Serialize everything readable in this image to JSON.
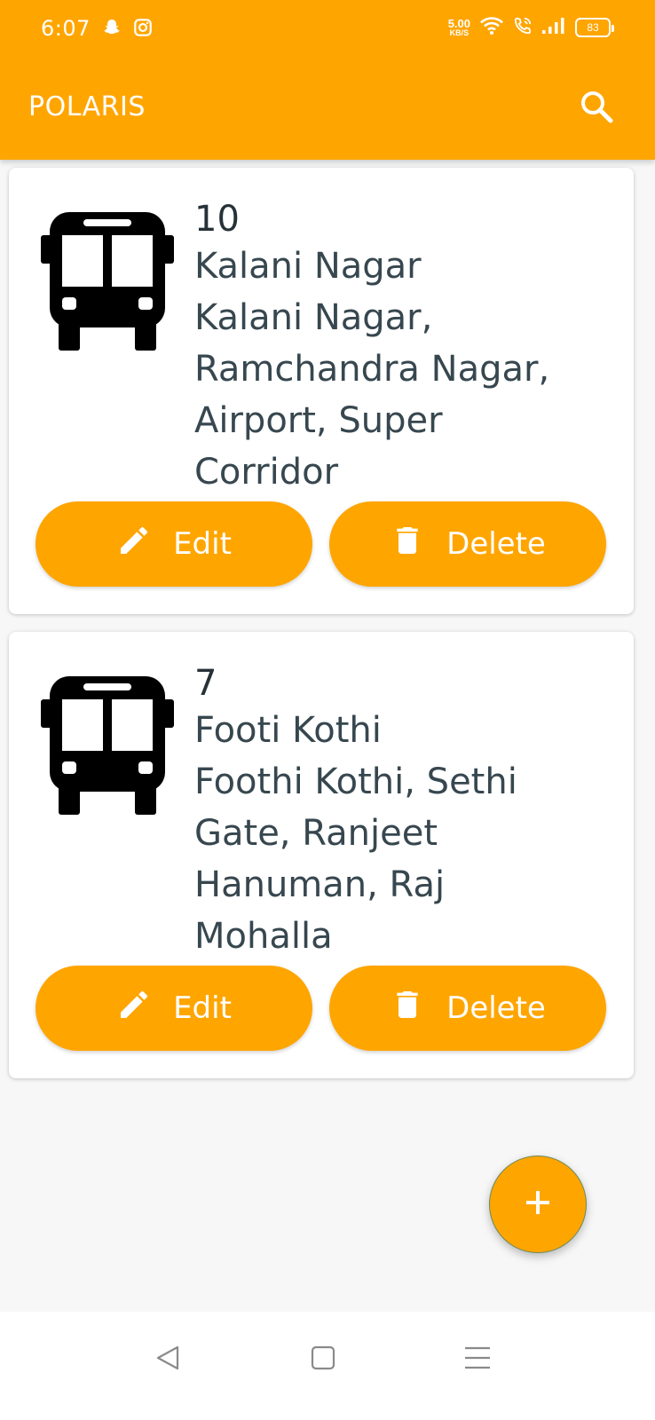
{
  "status_bar": {
    "time": "6:07",
    "net_speed_value": "5.00",
    "net_speed_unit": "KB/S",
    "battery": "83",
    "left_icons": [
      "snapchat-icon",
      "instagram-icon"
    ],
    "right_icons": [
      "wifi-icon",
      "wifi-call-icon",
      "signal-icon",
      "battery-icon"
    ]
  },
  "app_bar": {
    "title": "POLARIS",
    "search_icon": "search-icon"
  },
  "routes": [
    {
      "number": "10",
      "name": "Kalani Nagar",
      "stops_line1": "Kalani Nagar,",
      "stops_line2": "Ramchandra Nagar,",
      "stops_line3": "Airport,  Super",
      "stops_line4": "Corridor",
      "icon": "bus-icon",
      "edit_label": "Edit",
      "delete_label": "Delete"
    },
    {
      "number": "7",
      "name": "Footi Kothi",
      "stops_line1": "Foothi Kothi,  Sethi",
      "stops_line2": "Gate,  Ranjeet",
      "stops_line3": "Hanuman,  Raj",
      "stops_line4": "Mohalla",
      "icon": "bus-icon",
      "edit_label": "Edit",
      "delete_label": "Delete"
    }
  ],
  "fab": {
    "icon": "plus-icon"
  },
  "nav_bar": {
    "icons": [
      "back-icon",
      "home-icon",
      "menu-icon"
    ]
  },
  "colors": {
    "accent": "#ffa500",
    "text": "#37474f",
    "background": "#f7f7f7",
    "card": "#ffffff"
  }
}
